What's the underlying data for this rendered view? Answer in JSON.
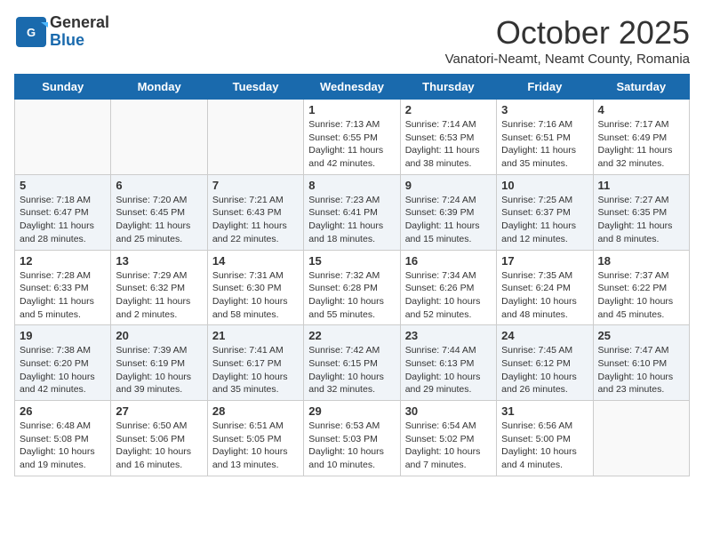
{
  "header": {
    "logo_general": "General",
    "logo_blue": "Blue",
    "month_title": "October 2025",
    "subtitle": "Vanatori-Neamt, Neamt County, Romania"
  },
  "calendar": {
    "days_of_week": [
      "Sunday",
      "Monday",
      "Tuesday",
      "Wednesday",
      "Thursday",
      "Friday",
      "Saturday"
    ],
    "weeks": [
      [
        {
          "day": "",
          "info": ""
        },
        {
          "day": "",
          "info": ""
        },
        {
          "day": "",
          "info": ""
        },
        {
          "day": "1",
          "info": "Sunrise: 7:13 AM\nSunset: 6:55 PM\nDaylight: 11 hours\nand 42 minutes."
        },
        {
          "day": "2",
          "info": "Sunrise: 7:14 AM\nSunset: 6:53 PM\nDaylight: 11 hours\nand 38 minutes."
        },
        {
          "day": "3",
          "info": "Sunrise: 7:16 AM\nSunset: 6:51 PM\nDaylight: 11 hours\nand 35 minutes."
        },
        {
          "day": "4",
          "info": "Sunrise: 7:17 AM\nSunset: 6:49 PM\nDaylight: 11 hours\nand 32 minutes."
        }
      ],
      [
        {
          "day": "5",
          "info": "Sunrise: 7:18 AM\nSunset: 6:47 PM\nDaylight: 11 hours\nand 28 minutes."
        },
        {
          "day": "6",
          "info": "Sunrise: 7:20 AM\nSunset: 6:45 PM\nDaylight: 11 hours\nand 25 minutes."
        },
        {
          "day": "7",
          "info": "Sunrise: 7:21 AM\nSunset: 6:43 PM\nDaylight: 11 hours\nand 22 minutes."
        },
        {
          "day": "8",
          "info": "Sunrise: 7:23 AM\nSunset: 6:41 PM\nDaylight: 11 hours\nand 18 minutes."
        },
        {
          "day": "9",
          "info": "Sunrise: 7:24 AM\nSunset: 6:39 PM\nDaylight: 11 hours\nand 15 minutes."
        },
        {
          "day": "10",
          "info": "Sunrise: 7:25 AM\nSunset: 6:37 PM\nDaylight: 11 hours\nand 12 minutes."
        },
        {
          "day": "11",
          "info": "Sunrise: 7:27 AM\nSunset: 6:35 PM\nDaylight: 11 hours\nand 8 minutes."
        }
      ],
      [
        {
          "day": "12",
          "info": "Sunrise: 7:28 AM\nSunset: 6:33 PM\nDaylight: 11 hours\nand 5 minutes."
        },
        {
          "day": "13",
          "info": "Sunrise: 7:29 AM\nSunset: 6:32 PM\nDaylight: 11 hours\nand 2 minutes."
        },
        {
          "day": "14",
          "info": "Sunrise: 7:31 AM\nSunset: 6:30 PM\nDaylight: 10 hours\nand 58 minutes."
        },
        {
          "day": "15",
          "info": "Sunrise: 7:32 AM\nSunset: 6:28 PM\nDaylight: 10 hours\nand 55 minutes."
        },
        {
          "day": "16",
          "info": "Sunrise: 7:34 AM\nSunset: 6:26 PM\nDaylight: 10 hours\nand 52 minutes."
        },
        {
          "day": "17",
          "info": "Sunrise: 7:35 AM\nSunset: 6:24 PM\nDaylight: 10 hours\nand 48 minutes."
        },
        {
          "day": "18",
          "info": "Sunrise: 7:37 AM\nSunset: 6:22 PM\nDaylight: 10 hours\nand 45 minutes."
        }
      ],
      [
        {
          "day": "19",
          "info": "Sunrise: 7:38 AM\nSunset: 6:20 PM\nDaylight: 10 hours\nand 42 minutes."
        },
        {
          "day": "20",
          "info": "Sunrise: 7:39 AM\nSunset: 6:19 PM\nDaylight: 10 hours\nand 39 minutes."
        },
        {
          "day": "21",
          "info": "Sunrise: 7:41 AM\nSunset: 6:17 PM\nDaylight: 10 hours\nand 35 minutes."
        },
        {
          "day": "22",
          "info": "Sunrise: 7:42 AM\nSunset: 6:15 PM\nDaylight: 10 hours\nand 32 minutes."
        },
        {
          "day": "23",
          "info": "Sunrise: 7:44 AM\nSunset: 6:13 PM\nDaylight: 10 hours\nand 29 minutes."
        },
        {
          "day": "24",
          "info": "Sunrise: 7:45 AM\nSunset: 6:12 PM\nDaylight: 10 hours\nand 26 minutes."
        },
        {
          "day": "25",
          "info": "Sunrise: 7:47 AM\nSunset: 6:10 PM\nDaylight: 10 hours\nand 23 minutes."
        }
      ],
      [
        {
          "day": "26",
          "info": "Sunrise: 6:48 AM\nSunset: 5:08 PM\nDaylight: 10 hours\nand 19 minutes."
        },
        {
          "day": "27",
          "info": "Sunrise: 6:50 AM\nSunset: 5:06 PM\nDaylight: 10 hours\nand 16 minutes."
        },
        {
          "day": "28",
          "info": "Sunrise: 6:51 AM\nSunset: 5:05 PM\nDaylight: 10 hours\nand 13 minutes."
        },
        {
          "day": "29",
          "info": "Sunrise: 6:53 AM\nSunset: 5:03 PM\nDaylight: 10 hours\nand 10 minutes."
        },
        {
          "day": "30",
          "info": "Sunrise: 6:54 AM\nSunset: 5:02 PM\nDaylight: 10 hours\nand 7 minutes."
        },
        {
          "day": "31",
          "info": "Sunrise: 6:56 AM\nSunset: 5:00 PM\nDaylight: 10 hours\nand 4 minutes."
        },
        {
          "day": "",
          "info": ""
        }
      ]
    ]
  }
}
